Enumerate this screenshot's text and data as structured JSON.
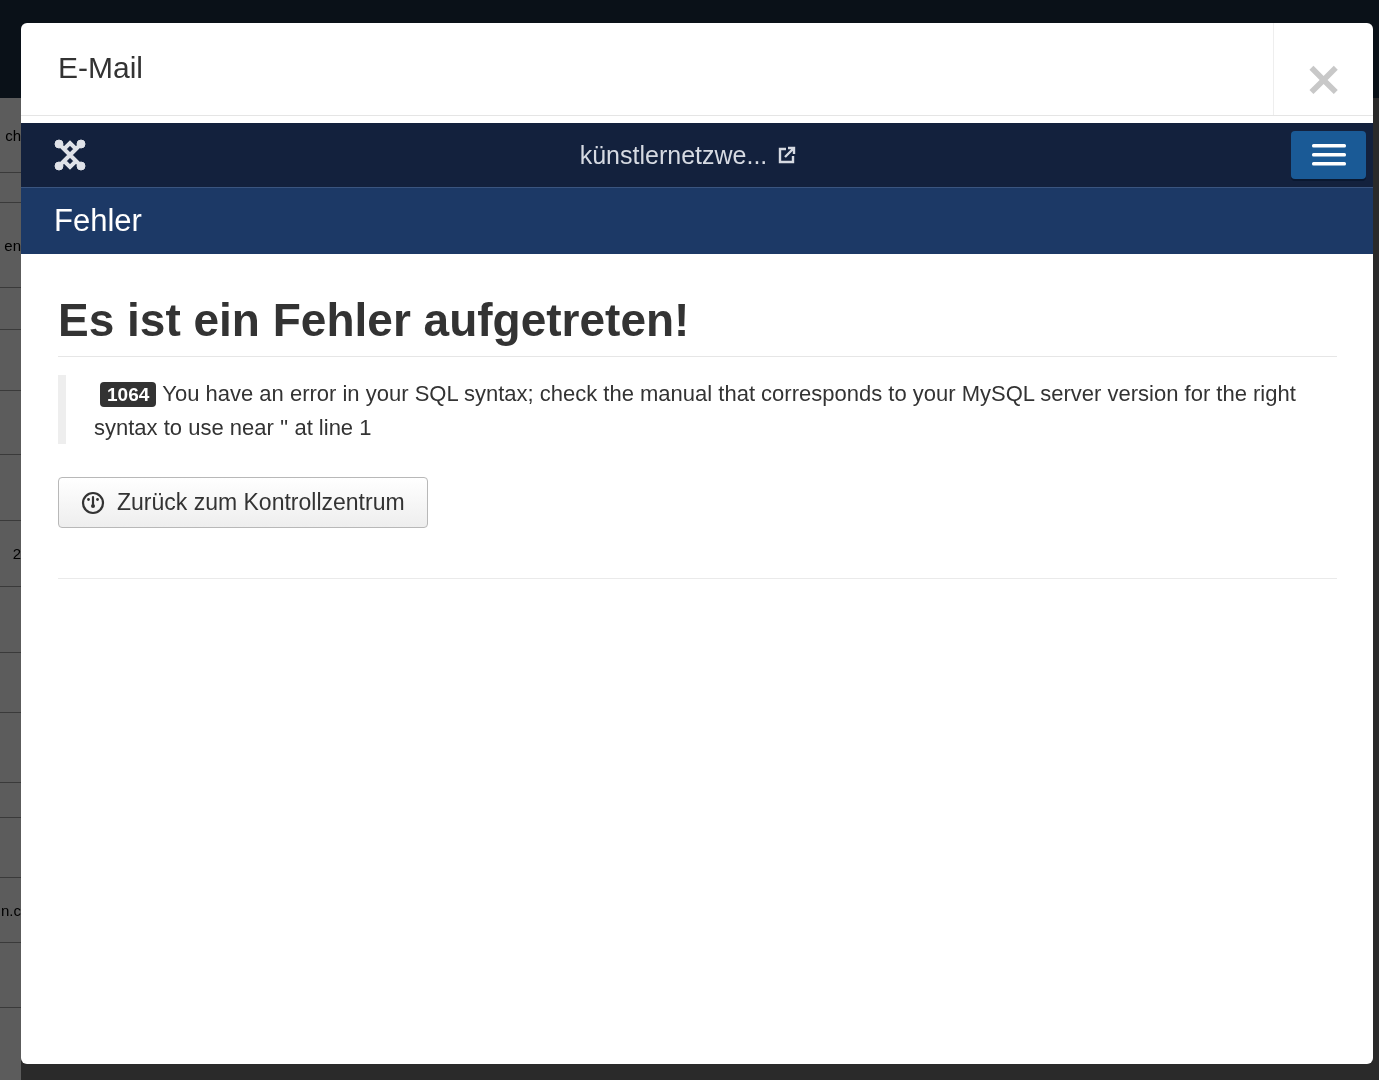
{
  "background_page": {
    "row_fragments": [
      {
        "text": "ch"
      },
      {
        "text": "en"
      },
      {
        "text": "2"
      },
      {
        "text": "n.c"
      }
    ]
  },
  "modal": {
    "title": "E-Mail",
    "close_label": "×",
    "navbar": {
      "site_link": "künstlernetzwe..."
    },
    "page_header": "Fehler",
    "heading": "Es ist ein Fehler aufgetreten!",
    "error": {
      "code": "1064",
      "message": "You have an error in your SQL syntax; check the manual that corresponds to your MySQL server version for the right syntax to use near '' at line 1"
    },
    "back_button": "Zurück zum Kontrollzentrum"
  }
}
